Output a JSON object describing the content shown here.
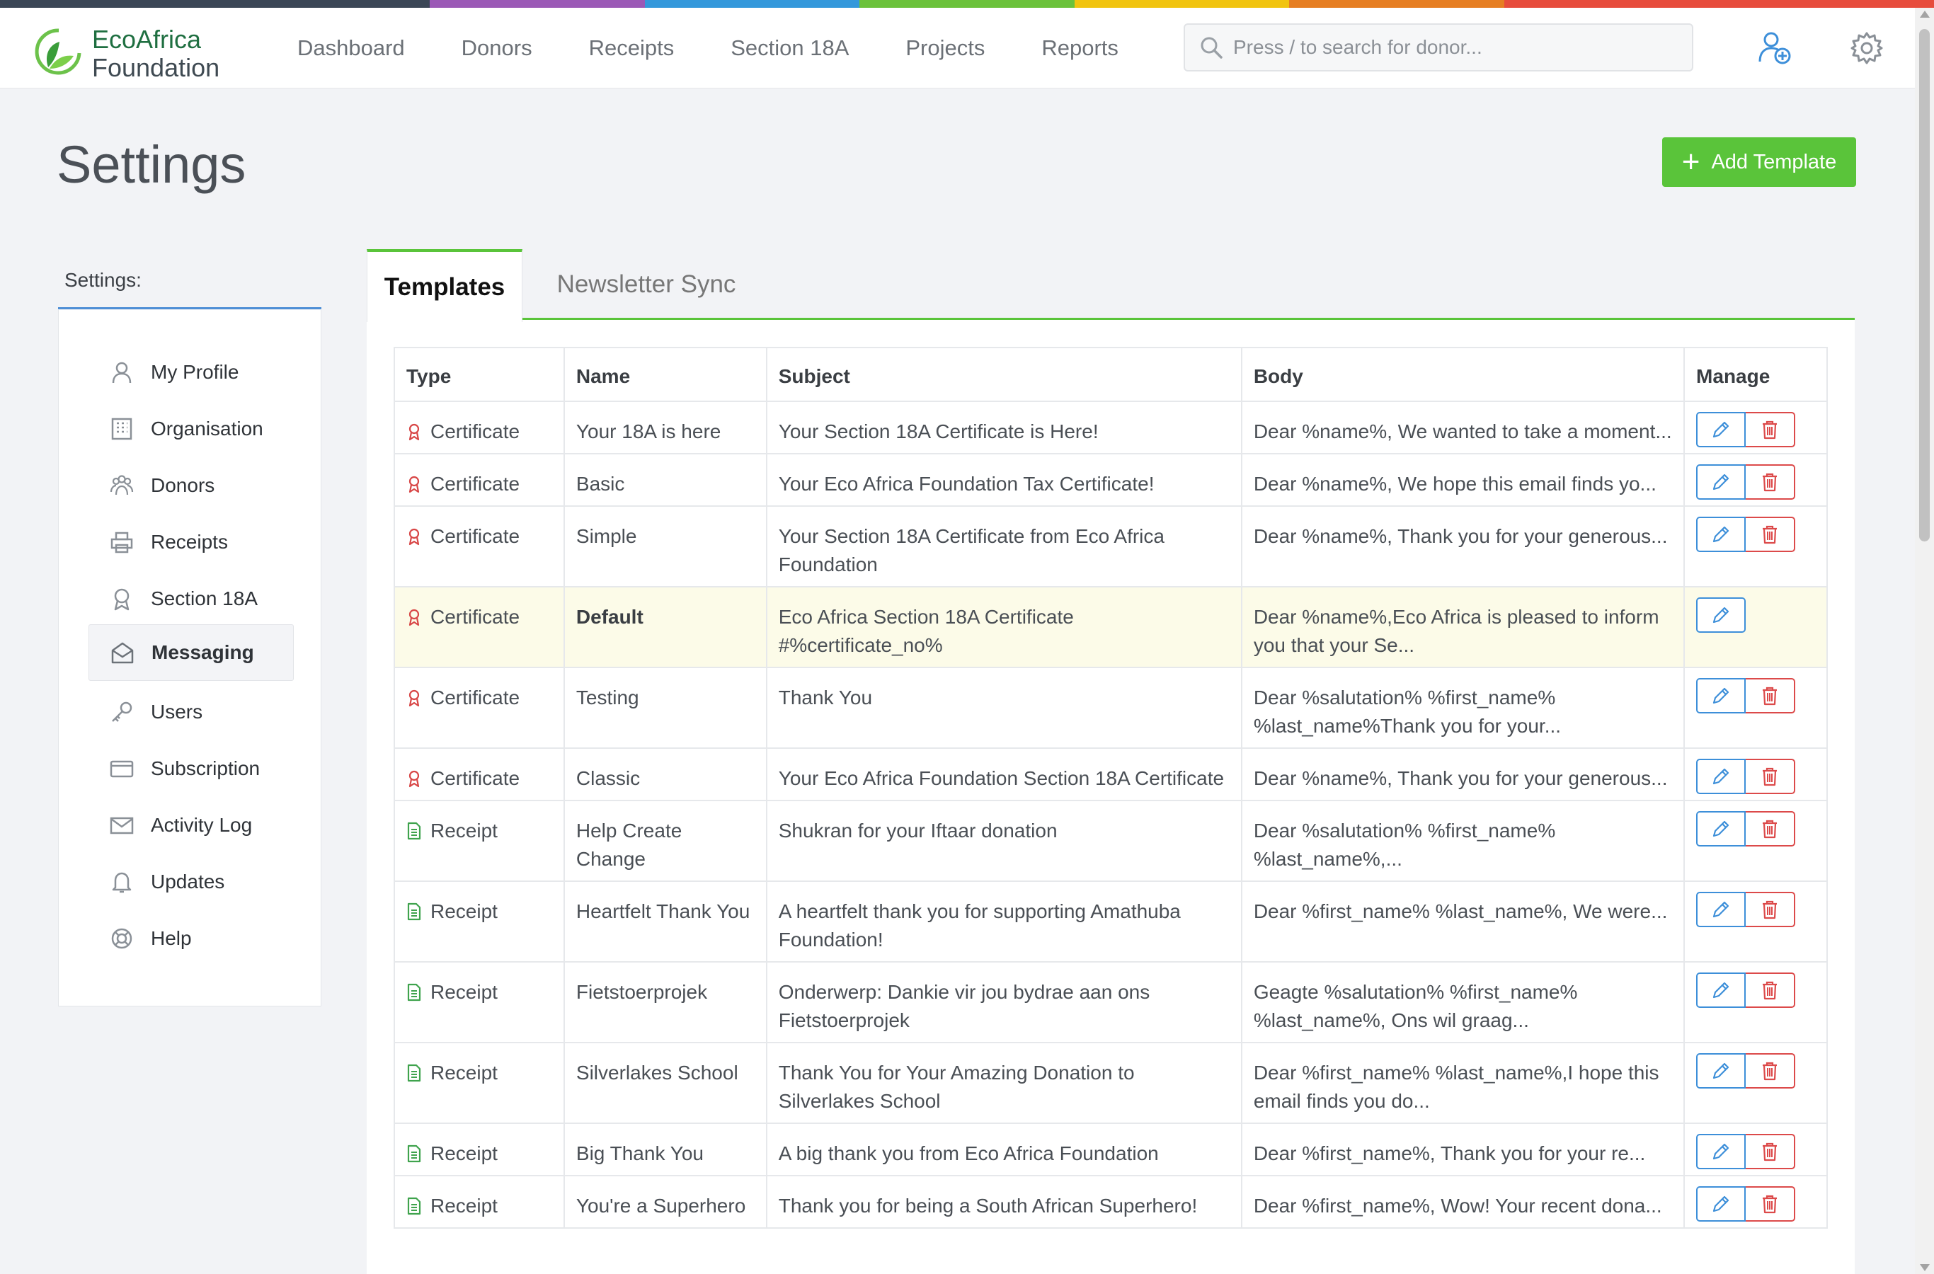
{
  "colors": {
    "stripe": [
      "#3b4656",
      "#3b4656",
      "#9b59b6",
      "#3498db",
      "#6bc23b",
      "#f1c40f",
      "#e67e22",
      "#e74c3c",
      "#e74c3c"
    ],
    "accent_green": "#5ac43a",
    "edit_blue": "#3d8fd9",
    "delete_red": "#dc4a4a",
    "highlight_row": "#fcfbe8"
  },
  "brand": {
    "line1": "EcoAfrica",
    "line2": "Foundation"
  },
  "nav": [
    "Dashboard",
    "Donors",
    "Receipts",
    "Section 18A",
    "Projects",
    "Reports"
  ],
  "search": {
    "placeholder": "Press / to search for donor..."
  },
  "header_icons": [
    "add-user-icon",
    "gear-icon"
  ],
  "page": {
    "title": "Settings",
    "add_button": "Add Template",
    "add_icon": "plus"
  },
  "sidebar": {
    "label": "Settings:",
    "items": [
      {
        "label": "My Profile",
        "icon": "user-icon"
      },
      {
        "label": "Organisation",
        "icon": "building-icon"
      },
      {
        "label": "Donors",
        "icon": "people-icon"
      },
      {
        "label": "Receipts",
        "icon": "printer-icon"
      },
      {
        "label": "Section 18A",
        "icon": "award-icon"
      },
      {
        "label": "Messaging",
        "icon": "envelope-open-icon",
        "active": true
      },
      {
        "label": "Users",
        "icon": "key-icon"
      },
      {
        "label": "Subscription",
        "icon": "credit-card-icon"
      },
      {
        "label": "Activity Log",
        "icon": "mail-icon"
      },
      {
        "label": "Updates",
        "icon": "bell-icon"
      },
      {
        "label": "Help",
        "icon": "lifebuoy-icon"
      }
    ]
  },
  "tabs": [
    {
      "label": "Templates",
      "active": true
    },
    {
      "label": "Newsletter Sync",
      "active": false
    }
  ],
  "table": {
    "headers": [
      "Type",
      "Name",
      "Subject",
      "Body",
      "Manage"
    ],
    "rows": [
      {
        "type": "Certificate",
        "name": "Your 18A is here",
        "subject": "Your Section 18A Certificate is Here!",
        "body": "Dear %name%, We wanted to take a moment...",
        "deletable": true
      },
      {
        "type": "Certificate",
        "name": "Basic",
        "subject": "Your Eco Africa Foundation Tax Certificate!",
        "body": "Dear %name%, We hope this email finds yo...",
        "deletable": true
      },
      {
        "type": "Certificate",
        "name": "Simple",
        "subject": "Your Section 18A Certificate from Eco Africa Foundation",
        "body": "Dear %name%, Thank you for your generous...",
        "deletable": true
      },
      {
        "type": "Certificate",
        "name": "Default",
        "subject": "Eco Africa Section 18A Certificate #%certificate_no%",
        "body": "Dear %name%,Eco Africa is pleased to inform you that your Se...",
        "deletable": false,
        "is_default": true
      },
      {
        "type": "Certificate",
        "name": "Testing",
        "subject": "Thank You",
        "body": "Dear %salutation% %first_name% %last_name%Thank you for your...",
        "deletable": true
      },
      {
        "type": "Certificate",
        "name": "Classic",
        "subject": "Your Eco Africa Foundation Section 18A Certificate",
        "body": "Dear %name%, Thank you for your generous...",
        "deletable": true
      },
      {
        "type": "Receipt",
        "name": "Help Create Change",
        "subject": "Shukran for your Iftaar donation",
        "body": "Dear %salutation% %first_name% %last_name%,...",
        "deletable": true
      },
      {
        "type": "Receipt",
        "name": "Heartfelt Thank You",
        "subject": "A heartfelt thank you for supporting Amathuba Foundation!",
        "body": "Dear %first_name% %last_name%, We were...",
        "deletable": true
      },
      {
        "type": "Receipt",
        "name": "Fietstoerprojek",
        "subject": "Onderwerp: Dankie vir jou bydrae aan ons Fietstoerprojek",
        "body": "Geagte %salutation% %first_name% %last_name%, Ons wil graag...",
        "deletable": true
      },
      {
        "type": "Receipt",
        "name": "Silverlakes School",
        "subject": "Thank You for Your Amazing Donation to Silverlakes School",
        "body": "Dear %first_name% %last_name%,I hope this email finds you do...",
        "deletable": true
      },
      {
        "type": "Receipt",
        "name": "Big Thank You",
        "subject": "A big thank you from Eco Africa Foundation",
        "body": "Dear %first_name%, Thank you for your re...",
        "deletable": true
      },
      {
        "type": "Receipt",
        "name": "You're a Superhero",
        "subject": "Thank you for being a South African Superhero!",
        "body": "Dear %first_name%, Wow! Your recent dona...",
        "deletable": true
      }
    ]
  }
}
